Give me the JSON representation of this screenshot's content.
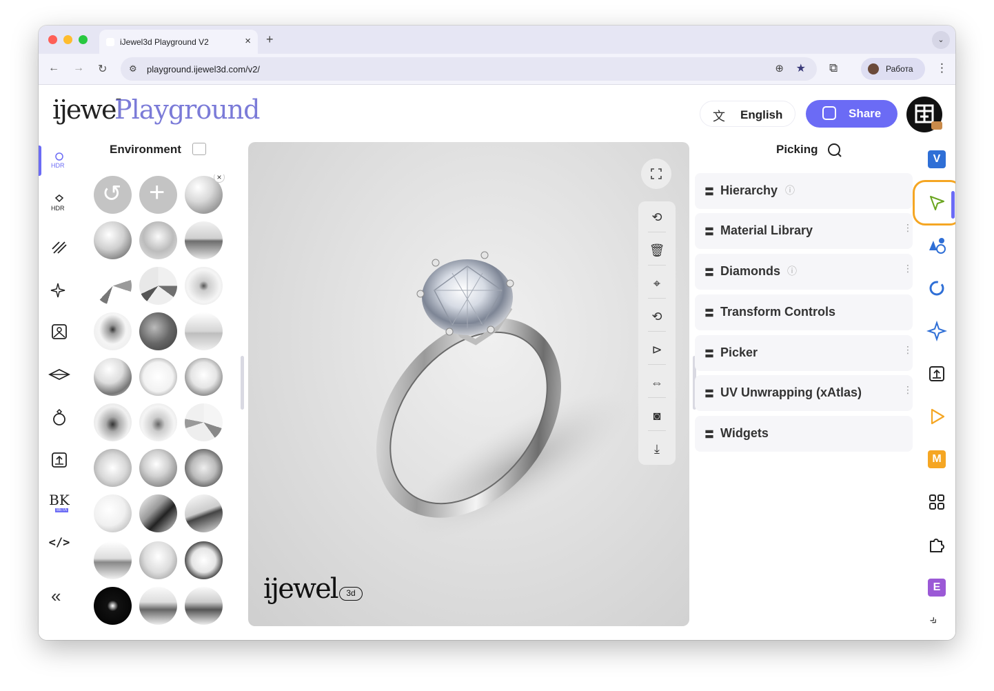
{
  "browser": {
    "tab_title": "iJewel3d Playground V2",
    "tab_close": "×",
    "new_tab": "+",
    "url": "playground.ijewel3d.com/v2/",
    "profile_name": "Работа",
    "nav_back": "←",
    "nav_forward": "→",
    "nav_reload": "↻",
    "menu": "⋮",
    "tab_menu": "⌄"
  },
  "header": {
    "logo_ijewel": "ijewel",
    "logo_playground": "Playground",
    "language_label": "English",
    "share_label": "Share"
  },
  "left_rail": {
    "items": [
      {
        "icon": "hdr-ring-icon",
        "label": "HDR"
      },
      {
        "icon": "hdr-diamond-icon",
        "label": "HDR"
      },
      {
        "icon": "texture-lines-icon",
        "label": ""
      },
      {
        "icon": "sparkle-icon",
        "label": ""
      },
      {
        "icon": "image-frame-icon",
        "label": ""
      },
      {
        "icon": "ground-plane-icon",
        "label": ""
      },
      {
        "icon": "ring-icon",
        "label": ""
      },
      {
        "icon": "export-icon",
        "label": ""
      },
      {
        "icon": "bk-beta-icon",
        "label": "BK",
        "badge": "BETA"
      },
      {
        "icon": "code-icon",
        "label": "</>"
      }
    ],
    "collapse": "«"
  },
  "environment": {
    "title": "Environment",
    "reset_label": "↺",
    "add_label": "+",
    "remove_label": "×"
  },
  "viewport": {
    "logo": "ijewel",
    "logo_badge": "3d",
    "tools": [
      "fullscreen-icon",
      "rotate-icon",
      "trash-icon",
      "focus-icon",
      "autorotate-icon",
      "play-icon",
      "compare-icon",
      "camera-icon",
      "download-icon"
    ]
  },
  "picking": {
    "title": "Picking",
    "plugins": [
      {
        "label": "Hierarchy",
        "info": true,
        "more": false
      },
      {
        "label": "Material Library",
        "info": false,
        "more": true
      },
      {
        "label": "Diamonds",
        "info": true,
        "more": true
      },
      {
        "label": "Transform Controls",
        "info": false,
        "more": false
      },
      {
        "label": "Picker",
        "info": false,
        "more": true
      },
      {
        "label": "UV Unwrapping (xAtlas)",
        "info": false,
        "more": true
      },
      {
        "label": "Widgets",
        "info": false,
        "more": false
      }
    ]
  },
  "right_rail": {
    "items": [
      {
        "icon": "v-badge-icon",
        "label": "V",
        "color": "#2f6fd6"
      },
      {
        "icon": "cursor-pick-icon",
        "label": "",
        "color": "#6aa51f"
      },
      {
        "icon": "shapes-icon",
        "label": "",
        "color": "#2f6fd6"
      },
      {
        "icon": "circle-dash-icon",
        "label": "",
        "color": "#2f6fd6"
      },
      {
        "icon": "star-4-icon",
        "label": "",
        "color": "#2f6fd6"
      },
      {
        "icon": "upload-box-icon",
        "label": "",
        "color": "#222222"
      },
      {
        "icon": "play-outline-icon",
        "label": "",
        "color": "#f5a623"
      },
      {
        "icon": "m-badge-icon",
        "label": "M",
        "color": "#f5a623"
      },
      {
        "icon": "grid-icon",
        "label": "",
        "color": "#222222"
      },
      {
        "icon": "puzzle-icon",
        "label": "",
        "color": "#222222"
      },
      {
        "icon": "e-badge-icon",
        "label": "E",
        "color": "#9b59d6"
      }
    ],
    "collapse": "»"
  },
  "colors": {
    "accent": "#6b6bf5",
    "highlight": "#f5a623"
  }
}
